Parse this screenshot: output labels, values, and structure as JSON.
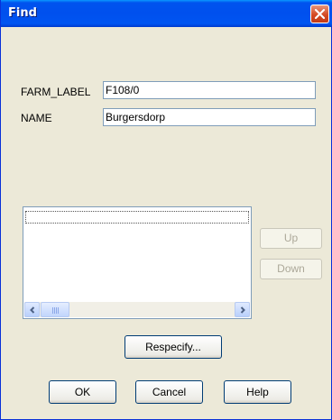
{
  "window": {
    "title": "Find"
  },
  "fields": [
    {
      "label": "FARM_LABEL",
      "value": "F108/0"
    },
    {
      "label": "NAME",
      "value": "Burgersdorp"
    }
  ],
  "list": {
    "items": [
      ""
    ]
  },
  "buttons": {
    "up": "Up",
    "down": "Down",
    "respecify": "Respecify...",
    "ok": "OK",
    "cancel": "Cancel",
    "help": "Help"
  },
  "icons": {
    "close": "close-icon",
    "scroll_left": "chevron-left-icon",
    "scroll_right": "chevron-right-icon"
  },
  "colors": {
    "titlebar": "#0054e3",
    "close": "#d44a24",
    "face": "#ece9d8",
    "field_border": "#7f9db9"
  }
}
